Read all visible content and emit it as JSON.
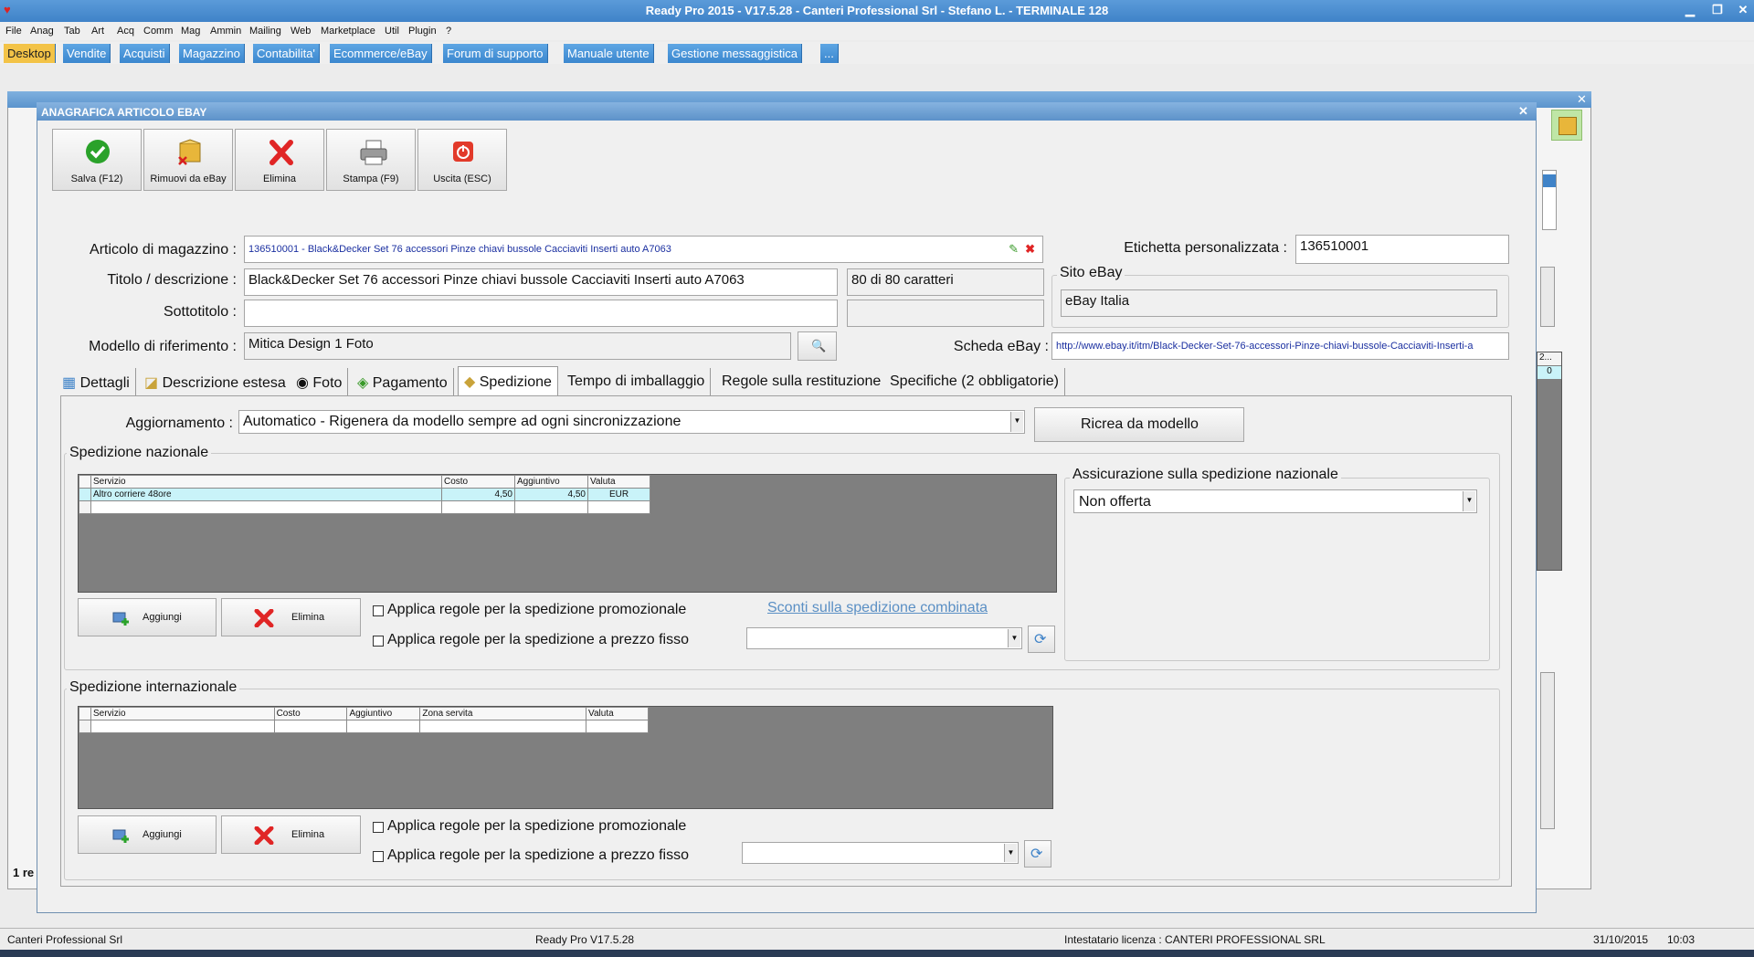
{
  "window": {
    "title": "Ready Pro 2015 - V17.5.28 - Canteri Professional Srl - Stefano L. - TERMINALE 128"
  },
  "menu": [
    "File",
    "Anag",
    "Tab",
    "Art",
    "Acq",
    "Comm",
    "Mag",
    "Ammin",
    "Mailing",
    "Web",
    "Marketplace",
    "Util",
    "Plugin",
    "?"
  ],
  "tabs": [
    "Desktop",
    "Vendite",
    "Acquisti",
    "Magazzino",
    "Contabilita'",
    "Ecommerce/eBay",
    "Forum di supporto",
    "Manuale utente",
    "Gestione messaggistica",
    "..."
  ],
  "dialog": {
    "title": "ANAGRAFICA ARTICOLO EBAY",
    "toolbar": {
      "save": "Salva (F12)",
      "remove": "Rimuovi da eBay",
      "delete": "Elimina",
      "print": "Stampa (F9)",
      "exit": "Uscita (ESC)"
    },
    "fields": {
      "articolo_label": "Articolo di magazzino :",
      "articolo_value": "136510001 - Black&Decker Set 76 accessori Pinze chiavi bussole Cacciaviti Inserti auto A7063",
      "etichetta_label": "Etichetta personalizzata :",
      "etichetta_value": "136510001",
      "titolo_label": "Titolo / descrizione :",
      "titolo_value": "Black&Decker Set 76 accessori Pinze chiavi bussole Cacciaviti Inserti auto A7063",
      "char_count": "80 di 80 caratteri",
      "sito_label": "Sito eBay",
      "sito_value": "eBay Italia",
      "sottotitolo_label": "Sottotitolo :",
      "sottotitolo_value": "",
      "modello_label": "Modello di riferimento :",
      "modello_value": "Mitica Design 1 Foto",
      "scheda_label": "Scheda eBay :",
      "scheda_value": "http://www.ebay.it/itm/Black-Decker-Set-76-accessori-Pinze-chiavi-bussole-Cacciaviti-Inserti-a"
    },
    "detail_tabs": [
      "Dettagli",
      "Descrizione estesa",
      "Foto",
      "Pagamento",
      "Spedizione",
      "Tempo di imballaggio",
      "Regole sulla restituzione",
      "Specifiche (2 obbligatorie)"
    ],
    "shipping": {
      "aggiornamento_label": "Aggiornamento :",
      "aggiornamento_value": "Automatico - Rigenera da modello sempre ad ogni sincronizzazione",
      "ricrea_button": "Ricrea da modello",
      "nazionale_title": "Spedizione nazionale",
      "nazionale_headers": [
        "Servizio",
        "Costo",
        "Aggiuntivo",
        "Valuta"
      ],
      "nazionale_rows": [
        [
          "Altro corriere 48ore",
          "4,50",
          "4,50",
          "EUR"
        ]
      ],
      "add_label": "Aggiungi",
      "delete_label": "Elimina",
      "promo_rule": "Applica regole per la spedizione promozionale",
      "fixed_rule": "Applica regole per la spedizione a prezzo fisso",
      "sconti_link": "Sconti sulla spedizione combinata",
      "assicurazione_title": "Assicurazione sulla spedizione nazionale",
      "assicurazione_value": "Non offerta",
      "internazionale_title": "Spedizione internazionale",
      "internazionale_headers": [
        "Servizio",
        "Costo",
        "Aggiuntivo",
        "Zona servita",
        "Valuta"
      ]
    }
  },
  "status": {
    "company": "Canteri Professional Srl",
    "version": "Ready Pro V17.5.28",
    "license": "Intestatario licenza : CANTERI PROFESSIONAL SRL",
    "date": "31/10/2015",
    "time": "10:03"
  },
  "background": {
    "records": "1 re",
    "list_value": "0",
    "col_label": "2..."
  },
  "colors": {
    "accent": "#3b87cf",
    "active_tab": "#f3c347",
    "selected_row": "#c9f3f9",
    "link": "#5a8fc4"
  }
}
